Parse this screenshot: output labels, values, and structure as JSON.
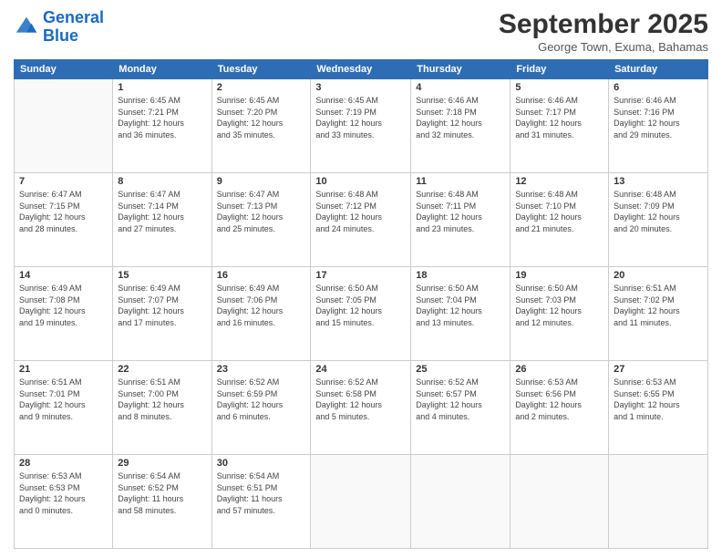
{
  "header": {
    "logo_line1": "General",
    "logo_line2": "Blue",
    "month": "September 2025",
    "location": "George Town, Exuma, Bahamas"
  },
  "weekdays": [
    "Sunday",
    "Monday",
    "Tuesday",
    "Wednesday",
    "Thursday",
    "Friday",
    "Saturday"
  ],
  "weeks": [
    [
      {
        "day": "",
        "info": ""
      },
      {
        "day": "1",
        "info": "Sunrise: 6:45 AM\nSunset: 7:21 PM\nDaylight: 12 hours\nand 36 minutes."
      },
      {
        "day": "2",
        "info": "Sunrise: 6:45 AM\nSunset: 7:20 PM\nDaylight: 12 hours\nand 35 minutes."
      },
      {
        "day": "3",
        "info": "Sunrise: 6:45 AM\nSunset: 7:19 PM\nDaylight: 12 hours\nand 33 minutes."
      },
      {
        "day": "4",
        "info": "Sunrise: 6:46 AM\nSunset: 7:18 PM\nDaylight: 12 hours\nand 32 minutes."
      },
      {
        "day": "5",
        "info": "Sunrise: 6:46 AM\nSunset: 7:17 PM\nDaylight: 12 hours\nand 31 minutes."
      },
      {
        "day": "6",
        "info": "Sunrise: 6:46 AM\nSunset: 7:16 PM\nDaylight: 12 hours\nand 29 minutes."
      }
    ],
    [
      {
        "day": "7",
        "info": "Sunrise: 6:47 AM\nSunset: 7:15 PM\nDaylight: 12 hours\nand 28 minutes."
      },
      {
        "day": "8",
        "info": "Sunrise: 6:47 AM\nSunset: 7:14 PM\nDaylight: 12 hours\nand 27 minutes."
      },
      {
        "day": "9",
        "info": "Sunrise: 6:47 AM\nSunset: 7:13 PM\nDaylight: 12 hours\nand 25 minutes."
      },
      {
        "day": "10",
        "info": "Sunrise: 6:48 AM\nSunset: 7:12 PM\nDaylight: 12 hours\nand 24 minutes."
      },
      {
        "day": "11",
        "info": "Sunrise: 6:48 AM\nSunset: 7:11 PM\nDaylight: 12 hours\nand 23 minutes."
      },
      {
        "day": "12",
        "info": "Sunrise: 6:48 AM\nSunset: 7:10 PM\nDaylight: 12 hours\nand 21 minutes."
      },
      {
        "day": "13",
        "info": "Sunrise: 6:48 AM\nSunset: 7:09 PM\nDaylight: 12 hours\nand 20 minutes."
      }
    ],
    [
      {
        "day": "14",
        "info": "Sunrise: 6:49 AM\nSunset: 7:08 PM\nDaylight: 12 hours\nand 19 minutes."
      },
      {
        "day": "15",
        "info": "Sunrise: 6:49 AM\nSunset: 7:07 PM\nDaylight: 12 hours\nand 17 minutes."
      },
      {
        "day": "16",
        "info": "Sunrise: 6:49 AM\nSunset: 7:06 PM\nDaylight: 12 hours\nand 16 minutes."
      },
      {
        "day": "17",
        "info": "Sunrise: 6:50 AM\nSunset: 7:05 PM\nDaylight: 12 hours\nand 15 minutes."
      },
      {
        "day": "18",
        "info": "Sunrise: 6:50 AM\nSunset: 7:04 PM\nDaylight: 12 hours\nand 13 minutes."
      },
      {
        "day": "19",
        "info": "Sunrise: 6:50 AM\nSunset: 7:03 PM\nDaylight: 12 hours\nand 12 minutes."
      },
      {
        "day": "20",
        "info": "Sunrise: 6:51 AM\nSunset: 7:02 PM\nDaylight: 12 hours\nand 11 minutes."
      }
    ],
    [
      {
        "day": "21",
        "info": "Sunrise: 6:51 AM\nSunset: 7:01 PM\nDaylight: 12 hours\nand 9 minutes."
      },
      {
        "day": "22",
        "info": "Sunrise: 6:51 AM\nSunset: 7:00 PM\nDaylight: 12 hours\nand 8 minutes."
      },
      {
        "day": "23",
        "info": "Sunrise: 6:52 AM\nSunset: 6:59 PM\nDaylight: 12 hours\nand 6 minutes."
      },
      {
        "day": "24",
        "info": "Sunrise: 6:52 AM\nSunset: 6:58 PM\nDaylight: 12 hours\nand 5 minutes."
      },
      {
        "day": "25",
        "info": "Sunrise: 6:52 AM\nSunset: 6:57 PM\nDaylight: 12 hours\nand 4 minutes."
      },
      {
        "day": "26",
        "info": "Sunrise: 6:53 AM\nSunset: 6:56 PM\nDaylight: 12 hours\nand 2 minutes."
      },
      {
        "day": "27",
        "info": "Sunrise: 6:53 AM\nSunset: 6:55 PM\nDaylight: 12 hours\nand 1 minute."
      }
    ],
    [
      {
        "day": "28",
        "info": "Sunrise: 6:53 AM\nSunset: 6:53 PM\nDaylight: 12 hours\nand 0 minutes."
      },
      {
        "day": "29",
        "info": "Sunrise: 6:54 AM\nSunset: 6:52 PM\nDaylight: 11 hours\nand 58 minutes."
      },
      {
        "day": "30",
        "info": "Sunrise: 6:54 AM\nSunset: 6:51 PM\nDaylight: 11 hours\nand 57 minutes."
      },
      {
        "day": "",
        "info": ""
      },
      {
        "day": "",
        "info": ""
      },
      {
        "day": "",
        "info": ""
      },
      {
        "day": "",
        "info": ""
      }
    ]
  ]
}
